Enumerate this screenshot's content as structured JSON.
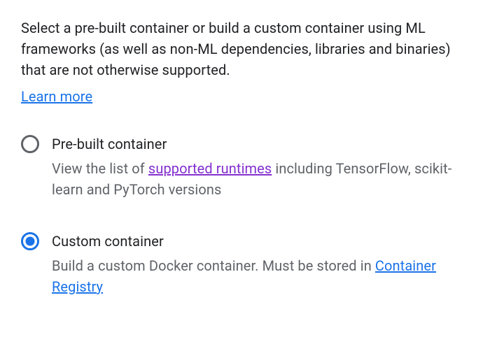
{
  "intro": {
    "text": "Select a pre-built container or build a custom container using ML frameworks (as well as non-ML dependencies, libraries and binaries) that are not otherwise supported.",
    "learn_more": "Learn more"
  },
  "options": {
    "prebuilt": {
      "title": "Pre-built container",
      "desc_prefix": "View the list of ",
      "link_text": "supported runtimes",
      "desc_suffix": " including TensorFlow, scikit-learn and PyTorch versions",
      "selected": false
    },
    "custom": {
      "title": "Custom container",
      "desc_prefix": "Build a custom Docker container. Must be stored in ",
      "link_text": "Container Registry",
      "selected": true
    }
  }
}
